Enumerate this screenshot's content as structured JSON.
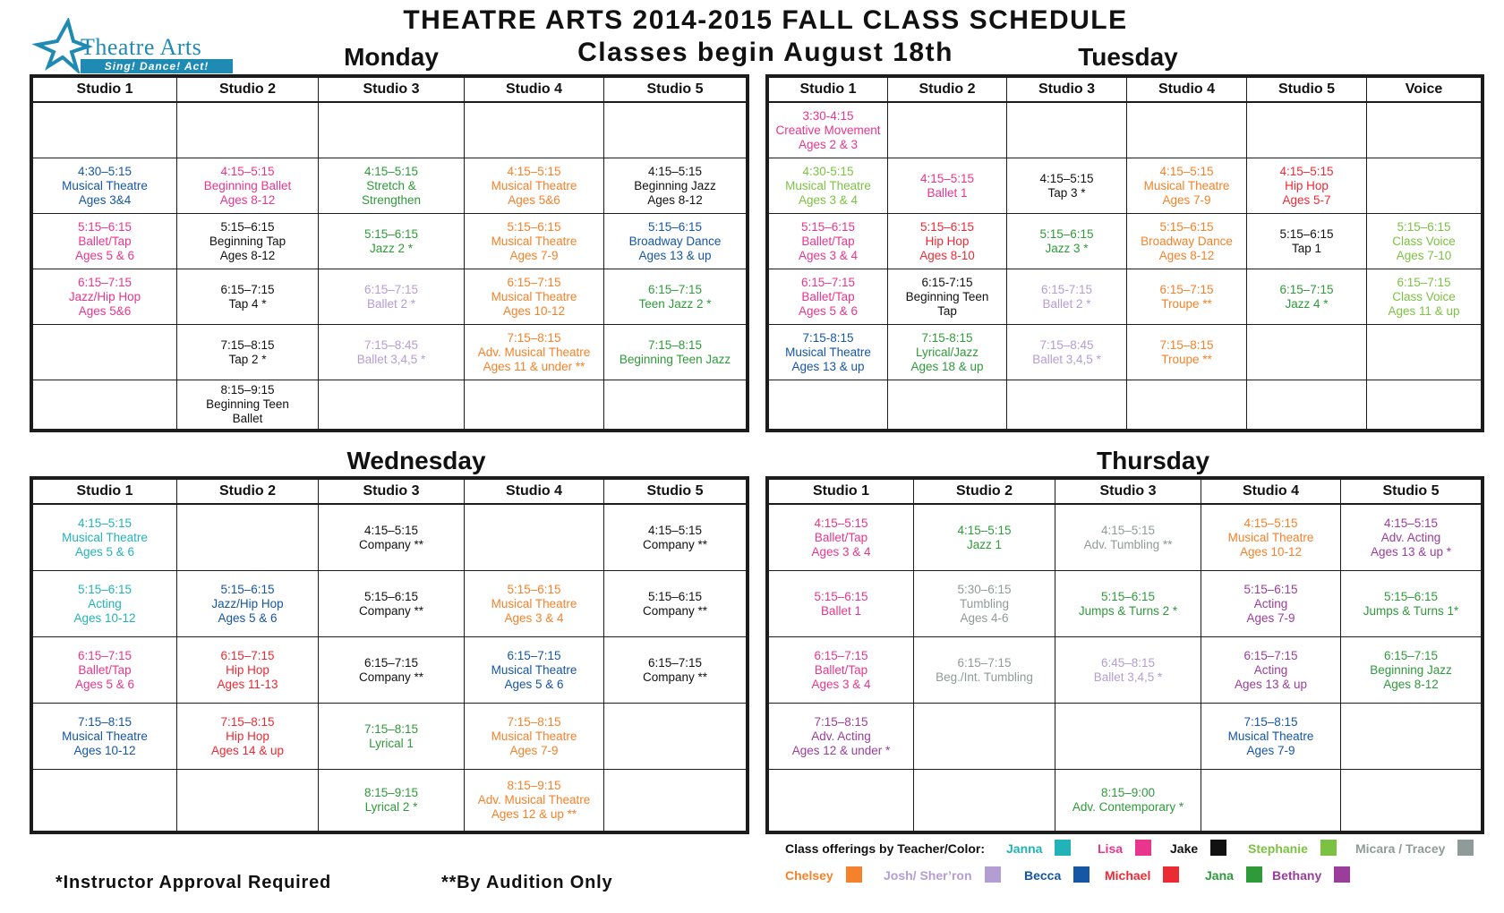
{
  "logo": {
    "name": "Theatre Arts",
    "tagline": "Sing! Dance! Act!"
  },
  "title": "THEATRE ARTS 2014-2015 FALL CLASS SCHEDULE",
  "subtitle": "Classes begin August 18th",
  "colors": {
    "janna": "#22b3b8",
    "lisa": "#e8368c",
    "jake": "#111111",
    "stephanie": "#7cc242",
    "micara": "#8f9b98",
    "chelsey": "#f5822a",
    "josh": "#b49dd3",
    "becca": "#1556a5",
    "michael": "#ec2a34",
    "jana": "#2f9a3a",
    "bethany": "#9b3d9a"
  },
  "monday": {
    "title": "Monday",
    "headers": [
      "Studio 1",
      "Studio 2",
      "Studio 3",
      "Studio 4",
      "Studio 5"
    ],
    "rows": [
      [
        {
          "l": []
        },
        {
          "l": []
        },
        {
          "l": []
        },
        {
          "l": []
        },
        {
          "l": []
        }
      ],
      [
        {
          "c": "becca",
          "l": [
            "4:30–5:15",
            "Musical Theatre",
            "Ages 3&4"
          ]
        },
        {
          "c": "lisa",
          "l": [
            "4:15–5:15",
            "Beginning Ballet",
            "Ages 8-12"
          ]
        },
        {
          "c": "jana",
          "l": [
            "4:15–5:15",
            "Stretch &",
            "Strengthen"
          ]
        },
        {
          "c": "chelsey",
          "l": [
            "4:15–5:15",
            "Musical Theatre",
            "Ages 5&6"
          ]
        },
        {
          "c": "jake",
          "l": [
            "4:15–5:15",
            "Beginning Jazz",
            "Ages 8-12"
          ]
        }
      ],
      [
        {
          "c": "lisa",
          "l": [
            "5:15–6:15",
            "Ballet/Tap",
            "Ages 5 & 6"
          ]
        },
        {
          "c": "jake",
          "l": [
            "5:15–6:15",
            "Beginning Tap",
            "Ages 8-12"
          ]
        },
        {
          "c": "jana",
          "l": [
            "5:15–6:15",
            "Jazz 2 *"
          ]
        },
        {
          "c": "chelsey",
          "l": [
            "5:15–6:15",
            "Musical Theatre",
            "Ages 7-9"
          ]
        },
        {
          "c": "becca",
          "l": [
            "5:15–6:15",
            "Broadway Dance",
            "Ages 13 & up"
          ]
        }
      ],
      [
        {
          "c": "lisa",
          "l": [
            "6:15–7:15",
            "Jazz/Hip Hop",
            "Ages 5&6"
          ]
        },
        {
          "c": "jake",
          "l": [
            "6:15–7:15",
            "Tap 4 *"
          ]
        },
        {
          "c": "josh",
          "l": [
            "6:15–7:15",
            "Ballet 2 *"
          ]
        },
        {
          "c": "chelsey",
          "l": [
            "6:15–7:15",
            "Musical Theatre",
            "Ages 10-12"
          ]
        },
        {
          "c": "jana",
          "l": [
            "6:15–7:15",
            "Teen Jazz 2 *"
          ]
        }
      ],
      [
        {
          "l": []
        },
        {
          "c": "jake",
          "l": [
            "7:15–8:15",
            "Tap 2 *"
          ]
        },
        {
          "c": "josh",
          "l": [
            "7:15–8:45",
            "Ballet 3,4,5 *"
          ]
        },
        {
          "c": "chelsey",
          "l": [
            "7:15–8:15",
            "Adv. Musical Theatre",
            "Ages 11 & under **"
          ]
        },
        {
          "c": "jana",
          "l": [
            "7:15–8:15",
            "Beginning Teen Jazz"
          ]
        }
      ],
      [
        {
          "l": []
        },
        {
          "c": "jake",
          "l": [
            "8:15–9:15",
            "Beginning Teen",
            "Ballet"
          ]
        },
        {
          "l": []
        },
        {
          "l": []
        },
        {
          "l": []
        }
      ]
    ]
  },
  "tuesday": {
    "title": "Tuesday",
    "headers": [
      "Studio 1",
      "Studio 2",
      "Studio 3",
      "Studio 4",
      "Studio 5",
      "Voice"
    ],
    "rows": [
      [
        {
          "c": "lisa",
          "l": [
            "3:30-4:15",
            "Creative Movement",
            "Ages 2 & 3"
          ]
        },
        {
          "l": []
        },
        {
          "l": []
        },
        {
          "l": []
        },
        {
          "l": []
        },
        {
          "l": []
        }
      ],
      [
        {
          "c": "stephanie",
          "l": [
            "4:30-5:15",
            "Musical Theatre",
            "Ages 3 & 4"
          ]
        },
        {
          "c": "lisa",
          "l": [
            "4:15–5:15",
            "Ballet 1"
          ]
        },
        {
          "c": "jake",
          "l": [
            "4:15–5:15",
            "Tap 3 *"
          ]
        },
        {
          "c": "chelsey",
          "l": [
            "4:15–5:15",
            "Musical Theatre",
            "Ages 7-9"
          ]
        },
        {
          "c": "michael",
          "l": [
            "4:15–5:15",
            "Hip Hop",
            "Ages 5-7"
          ]
        },
        {
          "l": []
        }
      ],
      [
        {
          "c": "lisa",
          "l": [
            "5:15–6:15",
            "Ballet/Tap",
            "Ages 3 & 4"
          ]
        },
        {
          "c": "michael",
          "l": [
            "5:15–6:15",
            "Hip Hop",
            "Ages 8-10"
          ]
        },
        {
          "c": "jana",
          "l": [
            "5:15–6:15",
            "Jazz 3 *"
          ]
        },
        {
          "c": "chelsey",
          "l": [
            "5:15–6:15",
            "Broadway Dance",
            "Ages 8-12"
          ]
        },
        {
          "c": "jake",
          "l": [
            "5:15–6:15",
            "Tap 1"
          ]
        },
        {
          "c": "stephanie",
          "l": [
            "5:15–6:15",
            "Class Voice",
            "Ages 7-10"
          ]
        }
      ],
      [
        {
          "c": "lisa",
          "l": [
            "6:15–7:15",
            "Ballet/Tap",
            "Ages 5 & 6"
          ]
        },
        {
          "c": "jake",
          "l": [
            "6:15-7:15",
            "Beginning Teen",
            "Tap"
          ]
        },
        {
          "c": "josh",
          "l": [
            "6:15-7:15",
            "Ballet 2 *"
          ]
        },
        {
          "c": "chelsey",
          "l": [
            "6:15–7:15",
            "Troupe **"
          ]
        },
        {
          "c": "jana",
          "l": [
            "6:15–7:15",
            "Jazz 4 *"
          ]
        },
        {
          "c": "stephanie",
          "l": [
            "6:15–7:15",
            "Class Voice",
            "Ages 11 & up"
          ]
        }
      ],
      [
        {
          "c": "becca",
          "l": [
            "7:15-8:15",
            "Musical Theatre",
            "Ages 13 & up"
          ]
        },
        {
          "c": "jana",
          "l": [
            "7:15-8:15",
            "Lyrical/Jazz",
            "Ages 18 & up"
          ]
        },
        {
          "c": "josh",
          "l": [
            "7:15–8:45",
            "Ballet 3,4,5 *"
          ]
        },
        {
          "c": "chelsey",
          "l": [
            "7:15–8:15",
            "Troupe **"
          ]
        },
        {
          "l": []
        },
        {
          "l": []
        }
      ],
      [
        {
          "l": []
        },
        {
          "l": []
        },
        {
          "l": []
        },
        {
          "l": []
        },
        {
          "l": []
        },
        {
          "l": []
        }
      ]
    ]
  },
  "wednesday": {
    "title": "Wednesday",
    "headers": [
      "Studio 1",
      "Studio 2",
      "Studio 3",
      "Studio 4",
      "Studio 5"
    ],
    "rows": [
      [
        {
          "c": "janna",
          "l": [
            "4:15–5:15",
            "Musical Theatre",
            "Ages 5 & 6"
          ]
        },
        {
          "l": []
        },
        {
          "c": "jake",
          "l": [
            "4:15–5:15",
            "Company **"
          ]
        },
        {
          "l": []
        },
        {
          "c": "jake",
          "l": [
            "4:15–5:15",
            "Company **"
          ]
        }
      ],
      [
        {
          "c": "janna",
          "l": [
            "5:15–6:15",
            "Acting",
            "Ages 10-12"
          ]
        },
        {
          "c": "becca",
          "l": [
            "5:15–6:15",
            "Jazz/Hip Hop",
            "Ages 5 & 6"
          ]
        },
        {
          "c": "jake",
          "l": [
            "5:15–6:15",
            "Company **"
          ]
        },
        {
          "c": "chelsey",
          "l": [
            "5:15–6:15",
            "Musical Theatre",
            "Ages 3 & 4"
          ]
        },
        {
          "c": "jake",
          "l": [
            "5:15–6:15",
            "Company **"
          ]
        }
      ],
      [
        {
          "c": "lisa",
          "l": [
            "6:15–7:15",
            "Ballet/Tap",
            "Ages 5 & 6"
          ]
        },
        {
          "c": "michael",
          "l": [
            "6:15–7:15",
            "Hip Hop",
            "Ages 11-13"
          ]
        },
        {
          "c": "jake",
          "l": [
            "6:15–7:15",
            "Company **"
          ]
        },
        {
          "c": "becca",
          "l": [
            "6:15–7:15",
            "Musical Theatre",
            "Ages 5 & 6"
          ]
        },
        {
          "c": "jake",
          "l": [
            "6:15–7:15",
            "Company **"
          ]
        }
      ],
      [
        {
          "c": "becca",
          "l": [
            "7:15–8:15",
            "Musical Theatre",
            "Ages 10-12"
          ]
        },
        {
          "c": "michael",
          "l": [
            "7:15–8:15",
            "Hip Hop",
            "Ages 14 & up"
          ]
        },
        {
          "c": "jana",
          "l": [
            "7:15–8:15",
            "Lyrical 1"
          ]
        },
        {
          "c": "chelsey",
          "l": [
            "7:15–8:15",
            "Musical Theatre",
            "Ages 7-9"
          ]
        },
        {
          "l": []
        }
      ],
      [
        {
          "l": []
        },
        {
          "l": []
        },
        {
          "c": "jana",
          "l": [
            "8:15–9:15",
            "Lyrical 2 *"
          ]
        },
        {
          "c": "chelsey",
          "l": [
            "8:15–9:15",
            "Adv. Musical Theatre",
            "Ages 12 & up **"
          ]
        },
        {
          "l": []
        }
      ]
    ]
  },
  "thursday": {
    "title": "Thursday",
    "headers": [
      "Studio 1",
      "Studio 2",
      "Studio 3",
      "Studio 4",
      "Studio 5"
    ],
    "rows": [
      [
        {
          "c": "lisa",
          "l": [
            "4:15–5:15",
            "Ballet/Tap",
            "Ages 3 & 4"
          ]
        },
        {
          "c": "jana",
          "l": [
            "4:15–5:15",
            "Jazz 1"
          ]
        },
        {
          "c": "micara",
          "l": [
            "4:15–5:15",
            "Adv. Tumbling **"
          ]
        },
        {
          "c": "chelsey",
          "l": [
            "4:15–5:15",
            "Musical Theatre",
            "Ages 10-12"
          ]
        },
        {
          "c": "bethany",
          "l": [
            "4:15–5:15",
            "Adv. Acting",
            "Ages 13 & up *"
          ]
        }
      ],
      [
        {
          "c": "lisa",
          "l": [
            "5:15–6:15",
            "Ballet 1"
          ]
        },
        {
          "c": "micara",
          "l": [
            "5:30–6:15",
            "Tumbling",
            "Ages 4-6"
          ]
        },
        {
          "c": "jana",
          "l": [
            "5:15–6:15",
            "Jumps & Turns 2 *"
          ]
        },
        {
          "c": "bethany",
          "l": [
            "5:15–6:15",
            "Acting",
            "Ages 7-9"
          ]
        },
        {
          "c": "jana",
          "l": [
            "5:15–6:15",
            "Jumps & Turns 1*"
          ]
        }
      ],
      [
        {
          "c": "lisa",
          "l": [
            "6:15–7:15",
            "Ballet/Tap",
            "Ages 3 & 4"
          ]
        },
        {
          "c": "micara",
          "l": [
            "6:15–7:15",
            "Beg./Int. Tumbling"
          ]
        },
        {
          "c": "josh",
          "l": [
            "6:45–8:15",
            "Ballet 3,4,5 *"
          ]
        },
        {
          "c": "bethany",
          "l": [
            "6:15–7:15",
            "Acting",
            "Ages 13 & up"
          ]
        },
        {
          "c": "jana",
          "l": [
            "6:15–7:15",
            "Beginning Jazz",
            "Ages 8-12"
          ]
        }
      ],
      [
        {
          "c": "bethany",
          "l": [
            "7:15–8:15",
            "Adv. Acting",
            "Ages 12 & under *"
          ]
        },
        {
          "l": []
        },
        {
          "l": []
        },
        {
          "c": "becca",
          "l": [
            "7:15–8:15",
            "Musical Theatre",
            "Ages 7-9"
          ]
        },
        {
          "l": []
        }
      ],
      [
        {
          "l": []
        },
        {
          "l": []
        },
        {
          "c": "jana",
          "l": [
            "8:15–9:00",
            "Adv. Contemporary *"
          ]
        },
        {
          "l": []
        },
        {
          "l": []
        }
      ]
    ]
  },
  "legend": {
    "label": "Class offerings by Teacher/Color:",
    "items": [
      {
        "name": "Janna",
        "key": "janna"
      },
      {
        "name": "Lisa",
        "key": "lisa"
      },
      {
        "name": "Jake",
        "key": "jake"
      },
      {
        "name": "Stephanie",
        "key": "stephanie"
      },
      {
        "name": "Micara / Tracey",
        "key": "micara"
      },
      {
        "name": "Chelsey",
        "key": "chelsey"
      },
      {
        "name": "Josh/ Sher’ron",
        "key": "josh"
      },
      {
        "name": "Becca",
        "key": "becca"
      },
      {
        "name": "Michael",
        "key": "michael"
      },
      {
        "name": "Jana",
        "key": "jana"
      },
      {
        "name": "Bethany",
        "key": "bethany"
      }
    ]
  },
  "footnotes": {
    "instructor": "*Instructor Approval Required",
    "audition": "**By Audition Only"
  }
}
